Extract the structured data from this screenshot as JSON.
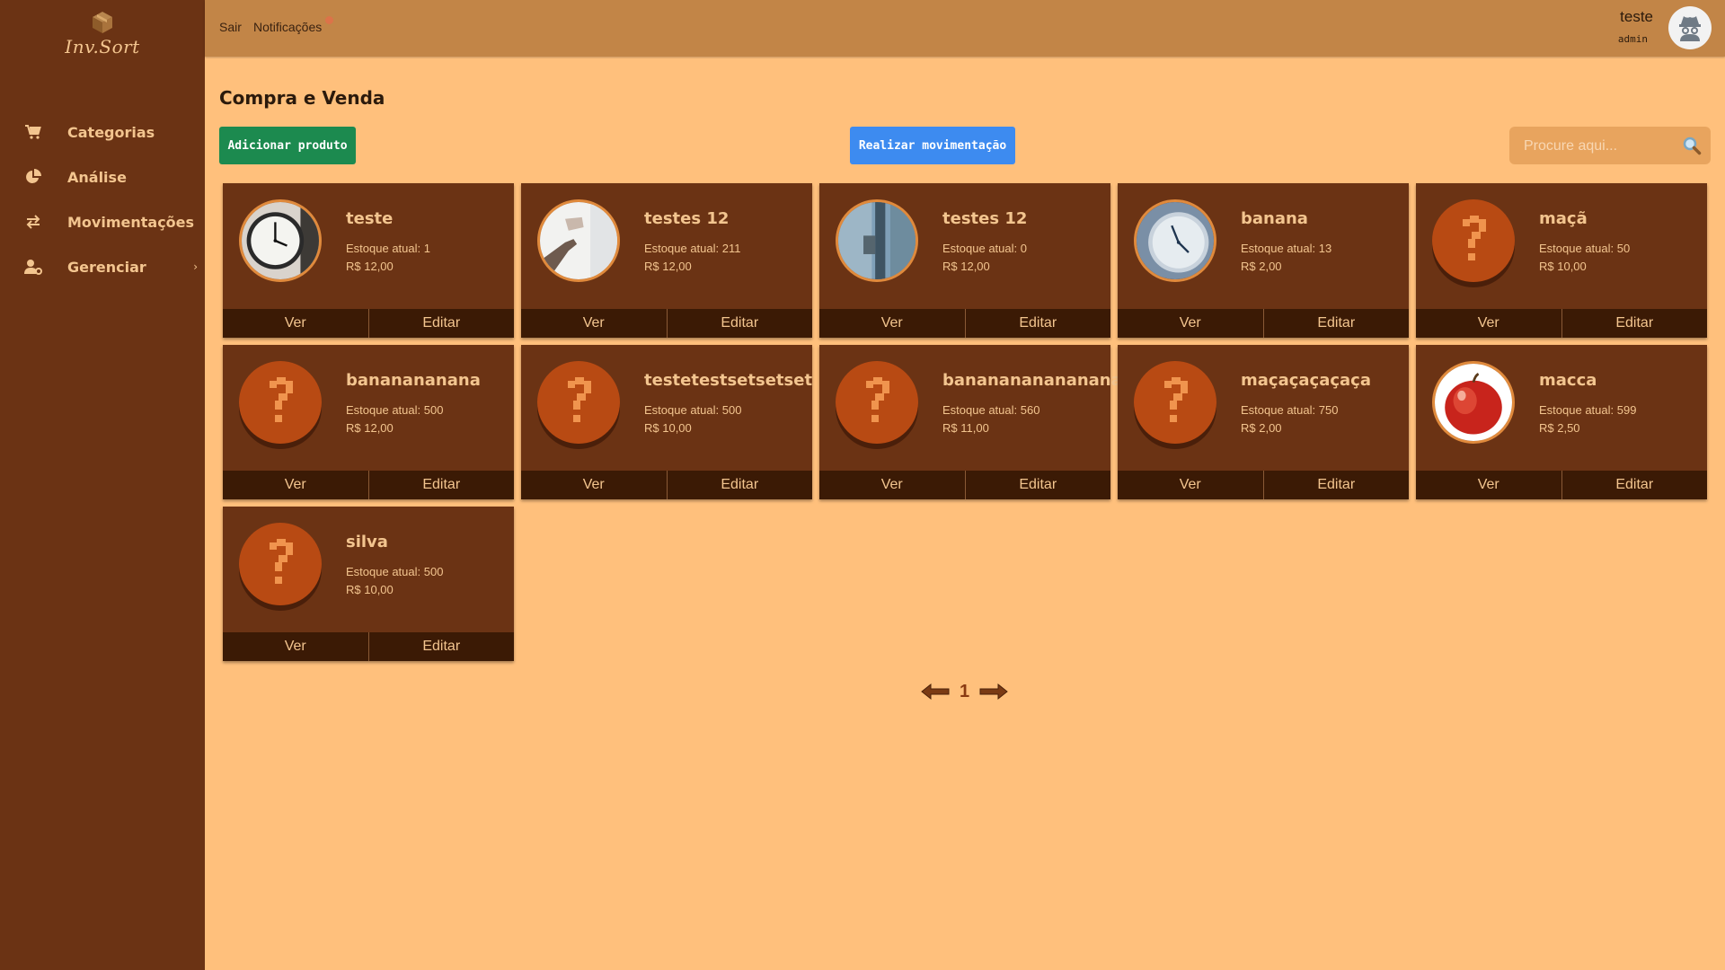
{
  "app": {
    "logo_text": "Inv.Sort"
  },
  "sidebar": {
    "items": [
      {
        "label": "Categorias",
        "icon": "cart-icon"
      },
      {
        "label": "Análise",
        "icon": "pie-chart-icon"
      },
      {
        "label": "Movimentações",
        "icon": "swap-arrows-icon"
      },
      {
        "label": "Gerenciar",
        "icon": "user-gear-icon",
        "has_submenu": true
      }
    ],
    "chevron": "›"
  },
  "topbar": {
    "logout_label": "Sair",
    "notifications_label": "Notificações",
    "user_name": "teste",
    "user_role": "admin"
  },
  "main": {
    "title": "Compra e Venda",
    "add_button_label": "Adicionar produto",
    "move_button_label": "Realizar movimentação",
    "search_placeholder": "Procure aqui...",
    "view_label": "Ver",
    "edit_label": "Editar"
  },
  "products": [
    {
      "name": "teste",
      "stock": "Estoque atual: 1",
      "price": "R$ 12,00",
      "image": "wall-clock-photo"
    },
    {
      "name": "testes 12",
      "stock": "Estoque atual: 211",
      "price": "R$ 12,00",
      "image": "hand-in-light-photo"
    },
    {
      "name": "testes 12",
      "stock": "Estoque atual: 0",
      "price": "R$ 12,00",
      "image": "door-handle-photo"
    },
    {
      "name": "banana",
      "stock": "Estoque atual: 13",
      "price": "R$ 2,00",
      "image": "blue-clock-photo"
    },
    {
      "name": "maçã",
      "stock": "Estoque atual: 50",
      "price": "R$ 10,00",
      "image": "question-mark-placeholder"
    },
    {
      "name": "bananananana",
      "stock": "Estoque atual: 500",
      "price": "R$ 12,00",
      "image": "question-mark-placeholder"
    },
    {
      "name": "testetestsetsetset",
      "stock": "Estoque atual: 500",
      "price": "R$ 10,00",
      "image": "question-mark-placeholder"
    },
    {
      "name": "banananananananan",
      "stock": "Estoque atual: 560",
      "price": "R$ 11,00",
      "image": "question-mark-placeholder"
    },
    {
      "name": "maçaçaçaçaça",
      "stock": "Estoque atual: 750",
      "price": "R$ 2,00",
      "image": "question-mark-placeholder"
    },
    {
      "name": "macca",
      "stock": "Estoque atual: 599",
      "price": "R$ 2,50",
      "image": "red-apple-photo"
    },
    {
      "name": "silva",
      "stock": "Estoque atual: 500",
      "price": "R$ 10,00",
      "image": "question-mark-placeholder"
    }
  ],
  "pagination": {
    "current_page": "1"
  },
  "colors": {
    "sidebar_bg": "#6B3314",
    "topbar_bg": "#C28547",
    "page_bg": "#FFC07C",
    "card_bg": "#6B3314",
    "card_actions_bg": "#3B1A05",
    "add_button": "#1C8A4F",
    "move_button": "#3D8BF0",
    "accent_text": "#F3C58F"
  }
}
